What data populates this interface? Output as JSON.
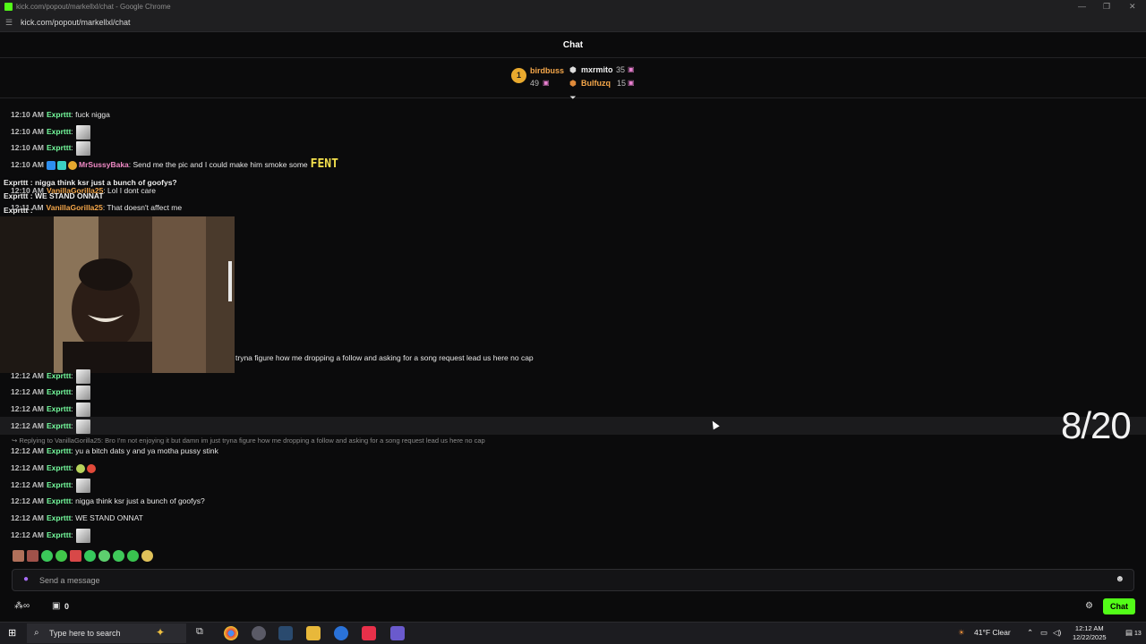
{
  "window": {
    "title": "kick.com/popout/markellxl/chat - Google Chrome",
    "url": "kick.com/popout/markellxl/chat"
  },
  "chat": {
    "header": "Chat",
    "leaderboard": {
      "first": {
        "rank": "1",
        "name": "birdbuss",
        "count": "49"
      },
      "second": {
        "name": "mxrmito",
        "count": "35"
      },
      "third": {
        "name": "Bulfuzq",
        "count": "15"
      }
    },
    "messages_top": [
      {
        "time": "12:10 AM",
        "user": "Exprttt",
        "text": ": fuck nigga"
      },
      {
        "time": "12:10 AM",
        "user": "Exprttt",
        "text": ":"
      },
      {
        "time": "12:10 AM",
        "user": "Exprttt",
        "text": ":"
      },
      {
        "time": "12:10 AM",
        "user": "MrSussyBaka",
        "text": ": Send me the pic and I could make him smoke some",
        "emote_text": "FENT"
      },
      {
        "time": "12:10 AM",
        "user": "VanillaGorilla25",
        "text": ": Lol I dont care"
      },
      {
        "time": "12:11 AM",
        "user": "VanillaGorilla25",
        "text": ": That doesn't affect me"
      }
    ],
    "overlay_lines": [
      "Exprttt : nigga think ksr just a bunch of goofys?",
      "Exprttt : WE STAND ONNAT",
      "Exprttt :"
    ],
    "long_message": "tryna figure how me dropping a follow and asking for a song request lead us here no cap",
    "messages_mid": [
      {
        "time": "12:12 AM",
        "user": "Exprttt",
        "text": ":"
      },
      {
        "time": "12:12 AM",
        "user": "Exprttt",
        "text": ":"
      },
      {
        "time": "12:12 AM",
        "user": "Exprttt",
        "text": ":"
      },
      {
        "time": "12:12 AM",
        "user": "Exprttt",
        "text": ":"
      }
    ],
    "reply_context": "Replying to VanillaGorilla25: Bro I'm not enjoying it but damn im just tryna figure how me dropping a follow and asking for a song request lead us here no cap",
    "messages_bottom": [
      {
        "time": "12:12 AM",
        "user": "Exprttt",
        "text": ": yu a bitch dats y and ya motha pussy stink"
      },
      {
        "time": "12:12 AM",
        "user": "Exprttt",
        "text": ":"
      },
      {
        "time": "12:12 AM",
        "user": "Exprttt",
        "text": ":"
      },
      {
        "time": "12:12 AM",
        "user": "Exprttt",
        "text": ": nigga think ksr just a bunch of goofys?"
      },
      {
        "time": "12:12 AM",
        "user": "Exprttt",
        "text": ": WE STAND ONNAT"
      },
      {
        "time": "12:12 AM",
        "user": "Exprttt",
        "text": ":"
      }
    ],
    "counter_overlay": "8/20",
    "input_placeholder": "Send a message",
    "points": "0",
    "send_button": "Chat"
  },
  "taskbar": {
    "search_placeholder": "Type here to search",
    "weather": "41°F  Clear",
    "time": "12:12 AM",
    "date": "12/22/2025",
    "notifications": "13"
  },
  "colors": {
    "accent": "#53fc18",
    "username_green": "#75fd9e",
    "username_orange": "#f5a74a"
  }
}
